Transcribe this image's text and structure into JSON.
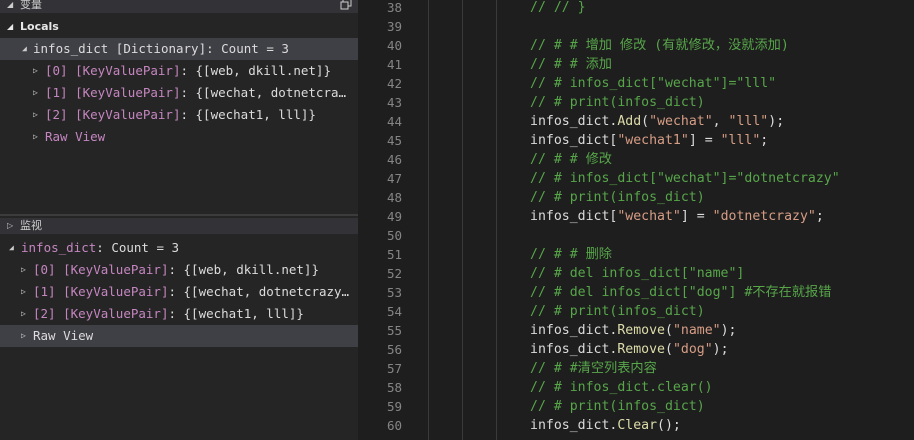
{
  "panels": {
    "variables": {
      "title": "变量",
      "section": "Locals",
      "root": {
        "name": "infos_dict",
        "type": "[Dictionary]",
        "summary": ": Count = 3"
      },
      "items": [
        {
          "index": "[0]",
          "type": "[KeyValuePair]",
          "value": ": {[web, dkill.net]}"
        },
        {
          "index": "[1]",
          "type": "[KeyValuePair]",
          "value": ": {[wechat, dotnetcra…"
        },
        {
          "index": "[2]",
          "type": "[KeyValuePair]",
          "value": ": {[wechat1, lll]}"
        }
      ],
      "raw_view": "Raw View"
    },
    "watch": {
      "title": "监视",
      "root": {
        "name": "infos_dict",
        "summary": ": Count = 3"
      },
      "items": [
        {
          "index": "[0]",
          "type": "[KeyValuePair]",
          "value": ": {[web, dkill.net]}"
        },
        {
          "index": "[1]",
          "type": "[KeyValuePair]",
          "value": ": {[wechat, dotnetcrazy…"
        },
        {
          "index": "[2]",
          "type": "[KeyValuePair]",
          "value": ": {[wechat1, lll]}"
        }
      ],
      "raw_view": "Raw View"
    }
  },
  "editor": {
    "lines": [
      {
        "n": "38",
        "tokens": [
          [
            "c",
            "// }"
          ]
        ]
      },
      {
        "n": "39",
        "tokens": []
      },
      {
        "n": "40",
        "tokens": [
          [
            "c",
            "# # 增加 修改 (有就修改，没就添加)"
          ]
        ]
      },
      {
        "n": "41",
        "tokens": [
          [
            "c",
            "# # 添加"
          ]
        ]
      },
      {
        "n": "42",
        "tokens": [
          [
            "c",
            "# infos_dict[\"wechat\"]=\"lll\""
          ]
        ]
      },
      {
        "n": "43",
        "tokens": [
          [
            "c",
            "# print(infos_dict)"
          ]
        ]
      },
      {
        "n": "44",
        "tokens": [
          [
            "i",
            "infos_dict."
          ],
          [
            "f",
            "Add"
          ],
          [
            "p",
            "("
          ],
          [
            "s",
            "\"wechat\""
          ],
          [
            "p",
            ", "
          ],
          [
            "s",
            "\"lll\""
          ],
          [
            "p",
            ");"
          ]
        ]
      },
      {
        "n": "45",
        "tokens": [
          [
            "i",
            "infos_dict["
          ],
          [
            "s",
            "\"wechat1\""
          ],
          [
            "p",
            "] = "
          ],
          [
            "s",
            "\"lll\""
          ],
          [
            "p",
            ";"
          ]
        ]
      },
      {
        "n": "46",
        "tokens": [
          [
            "c",
            "# # 修改"
          ]
        ]
      },
      {
        "n": "47",
        "tokens": [
          [
            "c",
            "# infos_dict[\"wechat\"]=\"dotnetcrazy\""
          ]
        ]
      },
      {
        "n": "48",
        "tokens": [
          [
            "c",
            "# print(infos_dict)"
          ]
        ]
      },
      {
        "n": "49",
        "tokens": [
          [
            "i",
            "infos_dict["
          ],
          [
            "s",
            "\"wechat\""
          ],
          [
            "p",
            "] = "
          ],
          [
            "s",
            "\"dotnetcrazy\""
          ],
          [
            "p",
            ";"
          ]
        ]
      },
      {
        "n": "50",
        "tokens": []
      },
      {
        "n": "51",
        "tokens": [
          [
            "c",
            "# # 删除"
          ]
        ]
      },
      {
        "n": "52",
        "tokens": [
          [
            "c",
            "# del infos_dict[\"name\"]"
          ]
        ]
      },
      {
        "n": "53",
        "tokens": [
          [
            "c",
            "# del infos_dict[\"dog\"] #不存在就报错"
          ]
        ]
      },
      {
        "n": "54",
        "tokens": [
          [
            "c",
            "# print(infos_dict)"
          ]
        ]
      },
      {
        "n": "55",
        "tokens": [
          [
            "i",
            "infos_dict."
          ],
          [
            "f",
            "Remove"
          ],
          [
            "p",
            "("
          ],
          [
            "s",
            "\"name\""
          ],
          [
            "p",
            ");"
          ]
        ]
      },
      {
        "n": "56",
        "tokens": [
          [
            "i",
            "infos_dict."
          ],
          [
            "f",
            "Remove"
          ],
          [
            "p",
            "("
          ],
          [
            "s",
            "\"dog\""
          ],
          [
            "p",
            ");"
          ]
        ]
      },
      {
        "n": "57",
        "tokens": [
          [
            "c",
            "# #清空列表内容"
          ]
        ]
      },
      {
        "n": "58",
        "tokens": [
          [
            "c",
            "# infos_dict.clear()"
          ]
        ]
      },
      {
        "n": "59",
        "tokens": [
          [
            "c",
            "# print(infos_dict)"
          ]
        ]
      },
      {
        "n": "60",
        "tokens": [
          [
            "i",
            "infos_dict."
          ],
          [
            "f",
            "Clear"
          ],
          [
            "p",
            "();"
          ]
        ]
      }
    ]
  }
}
